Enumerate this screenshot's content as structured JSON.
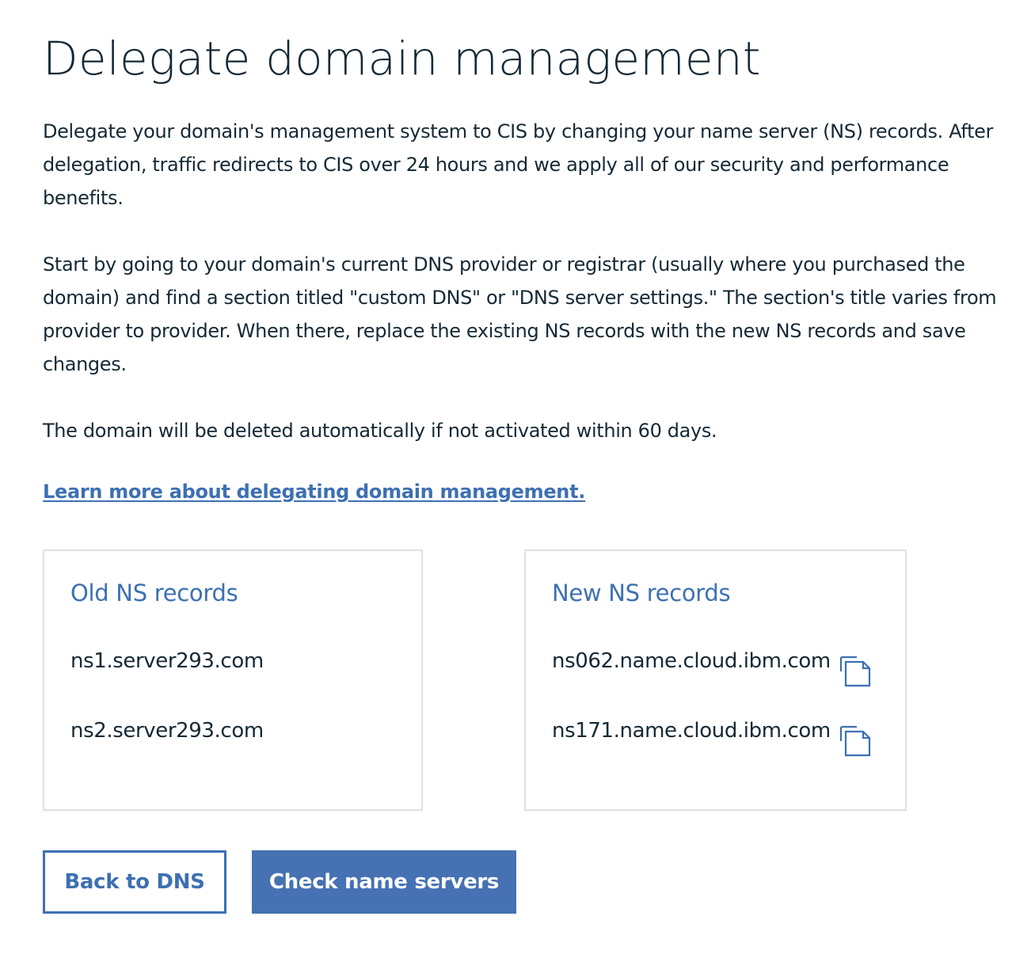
{
  "header": {
    "title": "Delegate domain management"
  },
  "content": {
    "paragraph_1": "Delegate your domain's management system to CIS by changing your name server (NS) records. After delegation, traffic redirects to CIS over 24 hours and we apply all of our security and performance benefits.",
    "paragraph_2": "Start by going to your domain's current DNS provider or registrar (usually where you purchased the domain) and find a section titled \"custom DNS\" or \"DNS server settings.\" The section's title varies from provider to provider. When there, replace the existing NS records with the new NS records and save changes.",
    "paragraph_3": "The domain will be deleted automatically if not activated within 60 days.",
    "learn_more_link": "Learn more about delegating domain management."
  },
  "old_records": {
    "title": "Old NS records",
    "items": [
      "ns1.server293.com",
      "ns2.server293.com"
    ]
  },
  "new_records": {
    "title": "New NS records",
    "items": [
      "ns062.name.cloud.ibm.com",
      "ns171.name.cloud.ibm.com"
    ],
    "copy_icon": "copy-icon"
  },
  "actions": {
    "back_label": "Back to DNS",
    "check_label": "Check name servers"
  },
  "colors": {
    "accent": "#3d70b2",
    "primary_button": "#4671b3",
    "text": "#152935",
    "card_border": "#dfe3e6"
  }
}
